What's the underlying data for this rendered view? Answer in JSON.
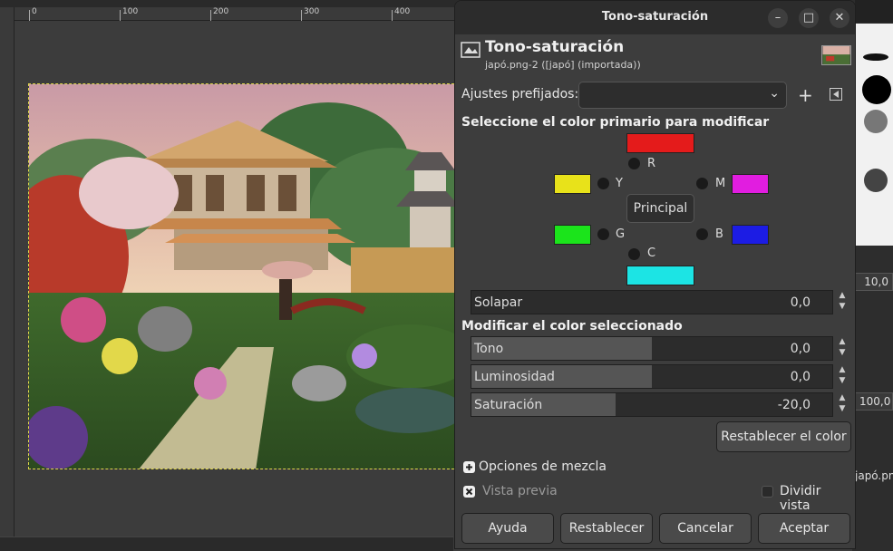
{
  "ruler": {
    "labels": [
      "0",
      "100",
      "200",
      "300",
      "400"
    ]
  },
  "right_panel": {
    "values": [
      "10,0",
      "100,0"
    ],
    "layer_name": "japó.png"
  },
  "dialog": {
    "window_title": "Tono-saturación",
    "header_title": "Tono-saturación",
    "header_subtitle": "japó.png-2 ([japó] (importada))",
    "presets_label": "Ajustes prefijados:",
    "primary_section": "Seleccione el color primario para modificar",
    "colors": {
      "R": {
        "label": "R",
        "color": "#e41b1b"
      },
      "Y": {
        "label": "Y",
        "color": "#e8e21a"
      },
      "M": {
        "label": "M",
        "color": "#e11de0"
      },
      "G": {
        "label": "G",
        "color": "#1be41b"
      },
      "B": {
        "label": "B",
        "color": "#1c1ce4"
      },
      "C": {
        "label": "C",
        "color": "#1ce4e4"
      }
    },
    "principal_label": "Principal",
    "overlap": {
      "label": "Solapar",
      "value": "0,0"
    },
    "modify_section": "Modificar el color seleccionado",
    "hue": {
      "label": "Tono",
      "value": "0,0",
      "fill": 0.5
    },
    "lightness": {
      "label": "Luminosidad",
      "value": "0,0",
      "fill": 0.5
    },
    "saturation": {
      "label": "Saturación",
      "value": "-20,0",
      "fill": 0.4
    },
    "reset_color": "Restablecer el color",
    "blend_options": "Opciones de mezcla",
    "preview": "Vista previa",
    "split_view": "Dividir vista",
    "buttons": {
      "help": "Ayuda",
      "reset": "Restablecer",
      "cancel": "Cancelar",
      "ok": "Aceptar"
    }
  }
}
